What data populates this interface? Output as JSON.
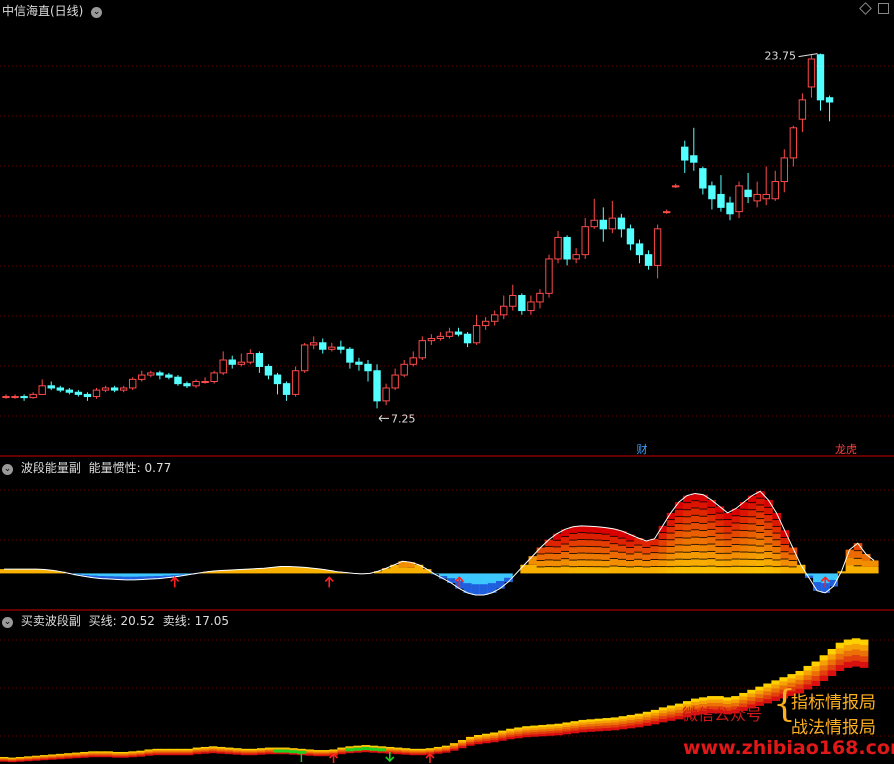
{
  "header": {
    "title": "中信海直(日线)",
    "diamond_icon": "diamond-icon",
    "square_icon": "square-icon"
  },
  "chart_data": [
    {
      "type": "candlestick",
      "title": "中信海直(日线)",
      "max_label": "23.75",
      "min_label": "7.25",
      "tags": [
        "财",
        "龙虎"
      ],
      "ylim": [
        5.5,
        25.5
      ],
      "candles": [
        [
          7.8,
          7.8,
          7.9,
          7.7
        ],
        [
          7.8,
          7.8,
          7.9,
          7.7
        ],
        [
          7.8,
          7.75,
          7.9,
          7.6
        ],
        [
          7.75,
          7.9,
          8.0,
          7.7
        ],
        [
          7.9,
          8.3,
          8.6,
          7.9
        ],
        [
          8.3,
          8.2,
          8.5,
          8.1
        ],
        [
          8.2,
          8.1,
          8.3,
          8.0
        ],
        [
          8.1,
          8.0,
          8.2,
          7.9
        ],
        [
          8.0,
          7.9,
          8.1,
          7.8
        ],
        [
          7.9,
          7.8,
          8.0,
          7.6
        ],
        [
          7.8,
          8.1,
          8.2,
          7.7
        ],
        [
          8.1,
          8.2,
          8.3,
          8.0
        ],
        [
          8.2,
          8.1,
          8.3,
          8.0
        ],
        [
          8.1,
          8.2,
          8.3,
          8.0
        ],
        [
          8.2,
          8.6,
          8.7,
          8.1
        ],
        [
          8.6,
          8.8,
          9.0,
          8.5
        ],
        [
          8.8,
          8.9,
          9.0,
          8.7
        ],
        [
          8.9,
          8.8,
          9.0,
          8.6
        ],
        [
          8.8,
          8.7,
          8.9,
          8.6
        ],
        [
          8.7,
          8.4,
          8.8,
          8.3
        ],
        [
          8.4,
          8.3,
          8.5,
          8.2
        ],
        [
          8.3,
          8.5,
          8.6,
          8.2
        ],
        [
          8.5,
          8.5,
          8.7,
          8.4
        ],
        [
          8.5,
          8.9,
          9.0,
          8.4
        ],
        [
          8.9,
          9.5,
          9.9,
          8.8
        ],
        [
          9.5,
          9.3,
          9.7,
          9.1
        ],
        [
          9.3,
          9.4,
          9.8,
          9.2
        ],
        [
          9.4,
          9.8,
          10.0,
          9.3
        ],
        [
          9.8,
          9.2,
          9.9,
          8.9
        ],
        [
          9.2,
          8.8,
          9.3,
          8.6
        ],
        [
          8.8,
          8.4,
          8.9,
          7.9
        ],
        [
          8.4,
          7.9,
          8.5,
          7.6
        ],
        [
          7.9,
          9.0,
          9.2,
          7.8
        ],
        [
          9.0,
          10.2,
          10.3,
          8.9
        ],
        [
          10.2,
          10.3,
          10.6,
          10.0
        ],
        [
          10.3,
          10.0,
          10.5,
          9.8
        ],
        [
          10.0,
          10.1,
          10.3,
          9.9
        ],
        [
          10.1,
          10.0,
          10.4,
          9.8
        ],
        [
          10.0,
          9.4,
          10.1,
          9.1
        ],
        [
          9.4,
          9.3,
          9.6,
          9.0
        ],
        [
          9.3,
          9.0,
          9.5,
          8.5
        ],
        [
          9.0,
          7.6,
          9.3,
          7.25
        ],
        [
          7.6,
          8.2,
          8.4,
          7.4
        ],
        [
          8.2,
          8.8,
          9.1,
          8.1
        ],
        [
          8.8,
          9.3,
          9.5,
          8.7
        ],
        [
          9.3,
          9.6,
          9.9,
          9.2
        ],
        [
          9.6,
          10.4,
          10.6,
          9.5
        ],
        [
          10.4,
          10.5,
          10.7,
          10.2
        ],
        [
          10.5,
          10.6,
          10.8,
          10.4
        ],
        [
          10.6,
          10.8,
          11.0,
          10.5
        ],
        [
          10.8,
          10.7,
          11.0,
          10.6
        ],
        [
          10.7,
          10.3,
          10.8,
          10.1
        ],
        [
          10.3,
          11.1,
          11.6,
          10.2
        ],
        [
          11.1,
          11.3,
          11.5,
          10.9
        ],
        [
          11.3,
          11.6,
          11.8,
          11.1
        ],
        [
          11.6,
          12.0,
          12.5,
          11.4
        ],
        [
          12.0,
          12.5,
          13.0,
          11.8
        ],
        [
          12.5,
          11.8,
          12.6,
          11.6
        ],
        [
          11.8,
          12.2,
          12.5,
          11.6
        ],
        [
          12.2,
          12.6,
          12.8,
          11.9
        ],
        [
          12.6,
          14.2,
          14.4,
          12.4
        ],
        [
          14.2,
          15.2,
          15.5,
          14.0
        ],
        [
          15.2,
          14.2,
          15.3,
          13.9
        ],
        [
          14.2,
          14.4,
          14.7,
          14.0
        ],
        [
          14.4,
          15.7,
          16.1,
          14.2
        ],
        [
          15.7,
          16.0,
          17.0,
          15.6
        ],
        [
          16.0,
          15.6,
          16.6,
          15.0
        ],
        [
          15.6,
          16.1,
          16.9,
          15.4
        ],
        [
          16.1,
          15.6,
          16.3,
          15.2
        ],
        [
          15.6,
          14.9,
          15.8,
          14.6
        ],
        [
          14.9,
          14.4,
          15.1,
          14.0
        ],
        [
          14.4,
          13.9,
          14.6,
          13.7
        ],
        [
          13.9,
          15.6,
          15.8,
          13.3
        ],
        [
          16.4,
          16.4,
          16.5,
          16.3
        ],
        [
          17.6,
          17.6,
          17.7,
          17.5
        ],
        [
          19.4,
          18.8,
          19.7,
          18.2
        ],
        [
          19.0,
          18.7,
          20.3,
          18.3
        ],
        [
          18.4,
          17.5,
          18.5,
          17.2
        ],
        [
          17.6,
          17.0,
          17.8,
          16.5
        ],
        [
          17.2,
          16.6,
          18.1,
          16.4
        ],
        [
          16.8,
          16.3,
          17.1,
          16.0
        ],
        [
          16.4,
          17.6,
          17.8,
          16.1
        ],
        [
          17.4,
          17.1,
          18.2,
          16.8
        ],
        [
          16.9,
          17.2,
          17.8,
          16.6
        ],
        [
          17.0,
          17.2,
          18.5,
          16.7
        ],
        [
          17.0,
          17.8,
          18.3,
          16.9
        ],
        [
          17.8,
          18.9,
          19.3,
          17.3
        ],
        [
          18.9,
          20.3,
          20.4,
          18.5
        ],
        [
          20.7,
          21.6,
          21.9,
          20.1
        ],
        [
          22.2,
          23.5,
          23.7,
          21.7
        ],
        [
          23.7,
          21.6,
          23.75,
          21.1
        ],
        [
          21.7,
          21.5,
          21.8,
          20.6
        ]
      ]
    },
    {
      "type": "area",
      "title": "波段能量副",
      "series": [
        {
          "name": "能量惯性",
          "value_label": "0.77",
          "values": [
            0.1,
            0.1,
            0.1,
            0.1,
            0.1,
            0.09,
            0.07,
            0.04,
            0.0,
            -0.04,
            -0.07,
            -0.1,
            -0.12,
            -0.13,
            -0.14,
            -0.15,
            -0.15,
            -0.14,
            -0.13,
            -0.12,
            -0.1,
            -0.08,
            -0.05,
            -0.02,
            0.01,
            0.04,
            0.06,
            0.07,
            0.08,
            0.09,
            0.1,
            0.11,
            0.12,
            0.14,
            0.16,
            0.16,
            0.15,
            0.14,
            0.12,
            0.1,
            0.07,
            0.04,
            0.02,
            0.0,
            -0.01,
            0.0,
            0.05,
            0.12,
            0.2,
            0.28,
            0.26,
            0.2,
            0.1,
            -0.02,
            -0.12,
            -0.22,
            -0.35,
            -0.45,
            -0.5,
            -0.5,
            -0.45,
            -0.35,
            -0.2,
            0.0,
            0.2,
            0.4,
            0.6,
            0.78,
            0.92,
            1.02,
            1.08,
            1.1,
            1.09,
            1.08,
            1.06,
            1.03,
            0.98,
            0.9,
            0.82,
            0.75,
            0.8,
            1.1,
            1.4,
            1.65,
            1.8,
            1.85,
            1.82,
            1.7,
            1.55,
            1.4,
            1.5,
            1.65,
            1.8,
            1.9,
            1.7,
            1.4,
            1.0,
            0.6,
            0.2,
            -0.1,
            -0.4,
            -0.45,
            -0.3,
            0.05,
            0.55,
            0.7,
            0.45,
            0.3
          ]
        }
      ],
      "ylim": [
        -0.8,
        2.3
      ],
      "arrows_up_at": [
        21,
        40,
        56,
        101
      ],
      "colors": {
        "warm_low": "#ffd400",
        "warm_high": "#d80000",
        "cool_top": "#3cc8ff",
        "cool_bottom": "#1a4cd8"
      }
    },
    {
      "type": "area",
      "title": "买卖波段副",
      "series": [
        {
          "name": "买线",
          "value_label": "20.52"
        },
        {
          "name": "卖线",
          "value_label": "17.05"
        }
      ],
      "values": [
        0.3,
        0.2,
        0.3,
        0.4,
        0.5,
        0.6,
        0.7,
        0.8,
        0.9,
        1.0,
        1.1,
        1.2,
        1.2,
        1.2,
        1.1,
        1.1,
        1.2,
        1.3,
        1.5,
        1.6,
        1.6,
        1.6,
        1.6,
        1.6,
        1.8,
        1.9,
        2.0,
        1.9,
        1.8,
        1.7,
        1.6,
        1.6,
        1.7,
        1.8,
        1.8,
        1.8,
        1.7,
        1.6,
        1.5,
        1.4,
        1.4,
        1.5,
        1.8,
        2.0,
        2.1,
        2.2,
        2.1,
        2.0,
        1.9,
        1.8,
        1.7,
        1.6,
        1.6,
        1.7,
        1.9,
        2.1,
        2.5,
        3.0,
        3.5,
        3.8,
        4.0,
        4.2,
        4.5,
        4.8,
        5.0,
        5.2,
        5.3,
        5.4,
        5.5,
        5.6,
        5.8,
        6.0,
        6.2,
        6.3,
        6.4,
        6.5,
        6.6,
        6.8,
        7.0,
        7.2,
        7.5,
        7.8,
        8.2,
        8.5,
        8.8,
        9.2,
        9.6,
        9.8,
        10.0,
        10.0,
        9.8,
        10.0,
        10.5,
        11.0,
        11.5,
        12.0,
        12.5,
        13.0,
        13.5,
        14.0,
        14.8,
        15.5,
        16.5,
        17.5,
        18.5,
        19.0,
        19.2,
        19.0
      ],
      "ylim": [
        -0.5,
        21
      ],
      "arrows_up_at": [
        41,
        53
      ],
      "arrows_down_at": [
        48
      ],
      "bracket_at": [
        37
      ],
      "colors": {
        "warm_low": "#ffd000",
        "warm_high": "#d81010",
        "green": "#20d020"
      }
    }
  ],
  "panel2": {
    "title": "波段能量副",
    "label": "能量惯性:",
    "value": "0.77"
  },
  "panel3": {
    "title": "买卖波段副",
    "buy_label": "买线:",
    "buy_value": "20.52",
    "sell_label": "卖线:",
    "sell_value": "17.05"
  },
  "watermark": {
    "wechat": "微信公众号",
    "line1": "指标情报局",
    "line2": "战法情报局",
    "url": "www.zhibiao168.com",
    "colors": {
      "wechat": "#d01818",
      "lines": "#ffb020",
      "url": "#e01818"
    }
  }
}
